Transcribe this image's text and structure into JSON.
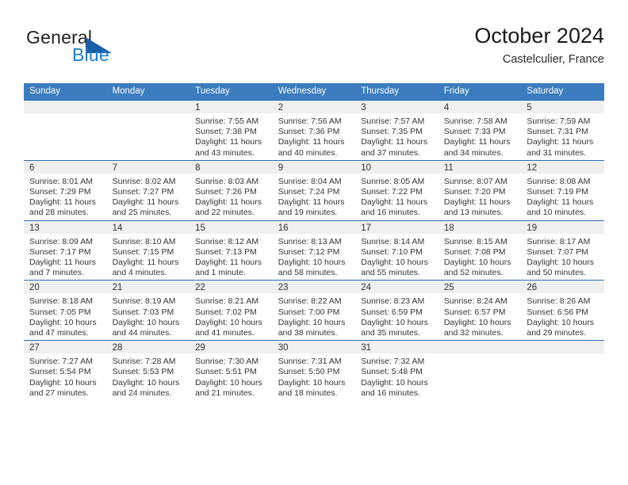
{
  "brand": {
    "name_top": "General",
    "name_bottom": "Blue",
    "accent_color": "#1a7fd4",
    "triangle_color": "#1b5fa8",
    "logo_icon": "triangle-flag-icon"
  },
  "header": {
    "month_title": "October 2024",
    "location": "Castelculier, France"
  },
  "calendar": {
    "header_bg": "#3a7cbe",
    "row_border_color": "#2f6fae",
    "daynum_band_bg": "#efefef",
    "weekdays": [
      "Sunday",
      "Monday",
      "Tuesday",
      "Wednesday",
      "Thursday",
      "Friday",
      "Saturday"
    ],
    "weeks": [
      [
        {
          "day": "",
          "empty": true
        },
        {
          "day": "",
          "empty": true
        },
        {
          "day": "1",
          "sunrise": "Sunrise: 7:55 AM",
          "sunset": "Sunset: 7:38 PM",
          "daylight_1": "Daylight: 11 hours",
          "daylight_2": "and 43 minutes."
        },
        {
          "day": "2",
          "sunrise": "Sunrise: 7:56 AM",
          "sunset": "Sunset: 7:36 PM",
          "daylight_1": "Daylight: 11 hours",
          "daylight_2": "and 40 minutes."
        },
        {
          "day": "3",
          "sunrise": "Sunrise: 7:57 AM",
          "sunset": "Sunset: 7:35 PM",
          "daylight_1": "Daylight: 11 hours",
          "daylight_2": "and 37 minutes."
        },
        {
          "day": "4",
          "sunrise": "Sunrise: 7:58 AM",
          "sunset": "Sunset: 7:33 PM",
          "daylight_1": "Daylight: 11 hours",
          "daylight_2": "and 34 minutes."
        },
        {
          "day": "5",
          "sunrise": "Sunrise: 7:59 AM",
          "sunset": "Sunset: 7:31 PM",
          "daylight_1": "Daylight: 11 hours",
          "daylight_2": "and 31 minutes."
        }
      ],
      [
        {
          "day": "6",
          "sunrise": "Sunrise: 8:01 AM",
          "sunset": "Sunset: 7:29 PM",
          "daylight_1": "Daylight: 11 hours",
          "daylight_2": "and 28 minutes."
        },
        {
          "day": "7",
          "sunrise": "Sunrise: 8:02 AM",
          "sunset": "Sunset: 7:27 PM",
          "daylight_1": "Daylight: 11 hours",
          "daylight_2": "and 25 minutes."
        },
        {
          "day": "8",
          "sunrise": "Sunrise: 8:03 AM",
          "sunset": "Sunset: 7:26 PM",
          "daylight_1": "Daylight: 11 hours",
          "daylight_2": "and 22 minutes."
        },
        {
          "day": "9",
          "sunrise": "Sunrise: 8:04 AM",
          "sunset": "Sunset: 7:24 PM",
          "daylight_1": "Daylight: 11 hours",
          "daylight_2": "and 19 minutes."
        },
        {
          "day": "10",
          "sunrise": "Sunrise: 8:05 AM",
          "sunset": "Sunset: 7:22 PM",
          "daylight_1": "Daylight: 11 hours",
          "daylight_2": "and 16 minutes."
        },
        {
          "day": "11",
          "sunrise": "Sunrise: 8:07 AM",
          "sunset": "Sunset: 7:20 PM",
          "daylight_1": "Daylight: 11 hours",
          "daylight_2": "and 13 minutes."
        },
        {
          "day": "12",
          "sunrise": "Sunrise: 8:08 AM",
          "sunset": "Sunset: 7:19 PM",
          "daylight_1": "Daylight: 11 hours",
          "daylight_2": "and 10 minutes."
        }
      ],
      [
        {
          "day": "13",
          "sunrise": "Sunrise: 8:09 AM",
          "sunset": "Sunset: 7:17 PM",
          "daylight_1": "Daylight: 11 hours",
          "daylight_2": "and 7 minutes."
        },
        {
          "day": "14",
          "sunrise": "Sunrise: 8:10 AM",
          "sunset": "Sunset: 7:15 PM",
          "daylight_1": "Daylight: 11 hours",
          "daylight_2": "and 4 minutes."
        },
        {
          "day": "15",
          "sunrise": "Sunrise: 8:12 AM",
          "sunset": "Sunset: 7:13 PM",
          "daylight_1": "Daylight: 11 hours",
          "daylight_2": "and 1 minute."
        },
        {
          "day": "16",
          "sunrise": "Sunrise: 8:13 AM",
          "sunset": "Sunset: 7:12 PM",
          "daylight_1": "Daylight: 10 hours",
          "daylight_2": "and 58 minutes."
        },
        {
          "day": "17",
          "sunrise": "Sunrise: 8:14 AM",
          "sunset": "Sunset: 7:10 PM",
          "daylight_1": "Daylight: 10 hours",
          "daylight_2": "and 55 minutes."
        },
        {
          "day": "18",
          "sunrise": "Sunrise: 8:15 AM",
          "sunset": "Sunset: 7:08 PM",
          "daylight_1": "Daylight: 10 hours",
          "daylight_2": "and 52 minutes."
        },
        {
          "day": "19",
          "sunrise": "Sunrise: 8:17 AM",
          "sunset": "Sunset: 7:07 PM",
          "daylight_1": "Daylight: 10 hours",
          "daylight_2": "and 50 minutes."
        }
      ],
      [
        {
          "day": "20",
          "sunrise": "Sunrise: 8:18 AM",
          "sunset": "Sunset: 7:05 PM",
          "daylight_1": "Daylight: 10 hours",
          "daylight_2": "and 47 minutes."
        },
        {
          "day": "21",
          "sunrise": "Sunrise: 8:19 AM",
          "sunset": "Sunset: 7:03 PM",
          "daylight_1": "Daylight: 10 hours",
          "daylight_2": "and 44 minutes."
        },
        {
          "day": "22",
          "sunrise": "Sunrise: 8:21 AM",
          "sunset": "Sunset: 7:02 PM",
          "daylight_1": "Daylight: 10 hours",
          "daylight_2": "and 41 minutes."
        },
        {
          "day": "23",
          "sunrise": "Sunrise: 8:22 AM",
          "sunset": "Sunset: 7:00 PM",
          "daylight_1": "Daylight: 10 hours",
          "daylight_2": "and 38 minutes."
        },
        {
          "day": "24",
          "sunrise": "Sunrise: 8:23 AM",
          "sunset": "Sunset: 6:59 PM",
          "daylight_1": "Daylight: 10 hours",
          "daylight_2": "and 35 minutes."
        },
        {
          "day": "25",
          "sunrise": "Sunrise: 8:24 AM",
          "sunset": "Sunset: 6:57 PM",
          "daylight_1": "Daylight: 10 hours",
          "daylight_2": "and 32 minutes."
        },
        {
          "day": "26",
          "sunrise": "Sunrise: 8:26 AM",
          "sunset": "Sunset: 6:56 PM",
          "daylight_1": "Daylight: 10 hours",
          "daylight_2": "and 29 minutes."
        }
      ],
      [
        {
          "day": "27",
          "sunrise": "Sunrise: 7:27 AM",
          "sunset": "Sunset: 5:54 PM",
          "daylight_1": "Daylight: 10 hours",
          "daylight_2": "and 27 minutes."
        },
        {
          "day": "28",
          "sunrise": "Sunrise: 7:28 AM",
          "sunset": "Sunset: 5:53 PM",
          "daylight_1": "Daylight: 10 hours",
          "daylight_2": "and 24 minutes."
        },
        {
          "day": "29",
          "sunrise": "Sunrise: 7:30 AM",
          "sunset": "Sunset: 5:51 PM",
          "daylight_1": "Daylight: 10 hours",
          "daylight_2": "and 21 minutes."
        },
        {
          "day": "30",
          "sunrise": "Sunrise: 7:31 AM",
          "sunset": "Sunset: 5:50 PM",
          "daylight_1": "Daylight: 10 hours",
          "daylight_2": "and 18 minutes."
        },
        {
          "day": "31",
          "sunrise": "Sunrise: 7:32 AM",
          "sunset": "Sunset: 5:48 PM",
          "daylight_1": "Daylight: 10 hours",
          "daylight_2": "and 16 minutes."
        },
        {
          "day": "",
          "empty": true
        },
        {
          "day": "",
          "empty": true
        }
      ]
    ]
  }
}
